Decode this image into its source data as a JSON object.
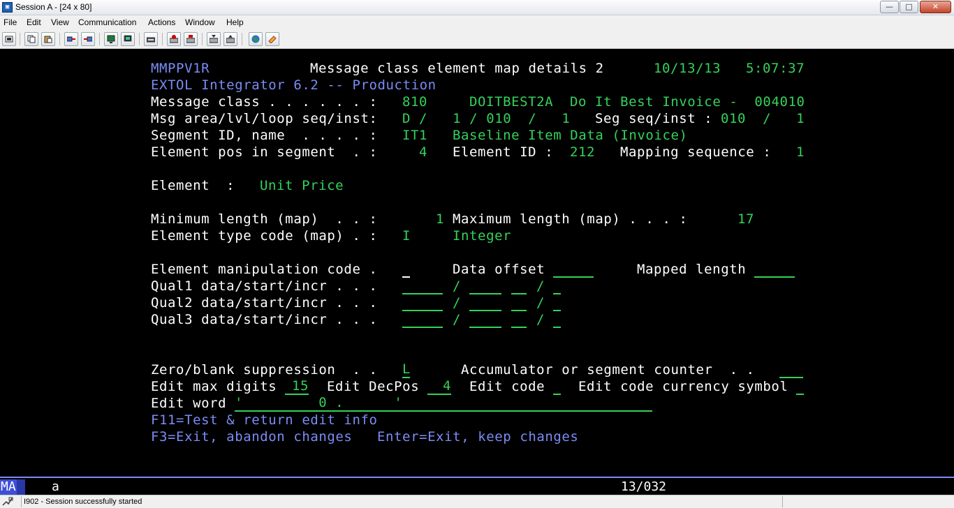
{
  "window": {
    "title": "Session A - [24 x 80]",
    "minimize_glyph": "—",
    "maximize_glyph": "□",
    "close_glyph": "✕"
  },
  "menu": [
    "File",
    "Edit",
    "View",
    "Communication",
    "Actions",
    "Window",
    "Help"
  ],
  "toolbar_icons": [
    "print-screen-icon",
    "copy-icon",
    "paste-icon",
    "send-icon",
    "receive-icon",
    "display-icon",
    "keyboard-icon",
    "macro-icon",
    "record-icon",
    "playback-icon",
    "stop-icon",
    "run-icon",
    "globe-icon",
    "help-icon"
  ],
  "screen": {
    "program_id": "MMPPV1R",
    "screen_title": "Message class element map details 2",
    "date": "10/13/13",
    "time": "5:07:37",
    "subtitle": "EXTOL Integrator 6.2 -- Production",
    "message_class_label": "Message class . . . . . . :",
    "message_class_value": "810",
    "message_class_name": "DOITBEST2A",
    "message_class_desc": "Do It Best Invoice -  004010",
    "area_label": "Msg area/lvl/loop seq/inst:",
    "area_value": "D /   1 / 010  /   1",
    "seg_inst_label": "Seg seq/inst :",
    "seg_inst_value": "010  /   1",
    "segment_label": "Segment ID, name  . . . . :",
    "segment_id": "IT1",
    "segment_name": "Baseline Item Data (Invoice)",
    "element_pos_label": "Element pos in segment  . :",
    "element_pos_value": "4",
    "element_id_label": "Element ID :",
    "element_id_value": "212",
    "mapping_seq_label": "Mapping sequence :",
    "mapping_seq_value": "1",
    "element_label": "Element  :",
    "element_value": "Unit Price",
    "min_length_label": "Minimum length (map)  . . :",
    "min_length_value": "1",
    "max_length_label": "Maximum length (map) . . . :",
    "max_length_value": "17",
    "type_code_label": "Element type code (map) . :",
    "type_code_value": "I",
    "type_code_desc": "Integer",
    "manip_label": "Element manipulation code .",
    "manip_value": "",
    "data_offset_label": "Data offset",
    "data_offset_value": "",
    "mapped_length_label": "Mapped length",
    "mapped_length_value": "",
    "qual1_label": "Qual1 data/start/incr . . .",
    "qual2_label": "Qual2 data/start/incr . . .",
    "qual3_label": "Qual3 data/start/incr . . .",
    "slash": "/",
    "zero_blank_label": "Zero/blank suppression  . .",
    "zero_blank_value": "L",
    "accum_label": "Accumulator or segment counter  . .",
    "accum_value": "",
    "edit_max_label": "Edit max digits",
    "edit_max_value": "15",
    "edit_decpos_label": "Edit DecPos",
    "edit_decpos_value": "4",
    "edit_code_label": "Edit code",
    "edit_code_value": "",
    "edit_currency_label": "Edit code currency symbol",
    "edit_currency_value": "",
    "edit_word_label": "Edit word",
    "edit_word_value": "'         0 .      '",
    "f11_text": "F11=Test & return edit info",
    "f3_text": "F3=Exit, abandon changes",
    "enter_text": "Enter=Exit, keep changes"
  },
  "oia": {
    "indicator": "MA",
    "keyboard_mode": "a",
    "cursor_pos": "13/032"
  },
  "status": {
    "message": "I902 - Session successfully started"
  }
}
